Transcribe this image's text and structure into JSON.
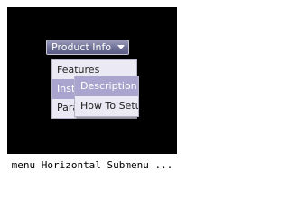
{
  "menu": {
    "button_label": "Product Info",
    "arrow_icon": "chevron-down-icon",
    "items": [
      {
        "label": "Features"
      },
      {
        "label": "Installation"
      },
      {
        "label": "Parameters"
      }
    ],
    "submenu": [
      {
        "label": "Description"
      },
      {
        "label": "How To Setup"
      }
    ]
  },
  "caption": "menu Horizontal Submenu ...",
  "colors": {
    "panel": "#000000",
    "highlight": "#a9a5ce",
    "menu_bg": "#ebe9f3",
    "button": "#6f7096"
  }
}
